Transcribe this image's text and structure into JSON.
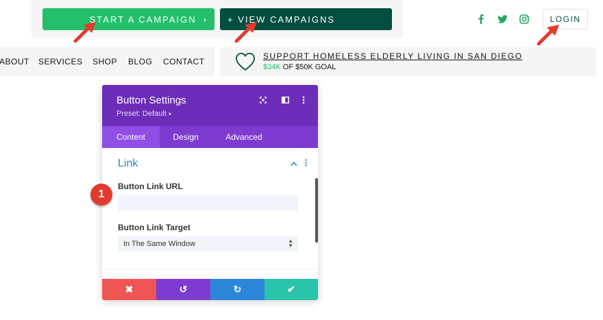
{
  "header": {
    "start_campaign": "START A CAMPAIGN",
    "start_chevron": "›",
    "view_campaigns": "+ VIEW CAMPAIGNS",
    "social_icons": [
      "facebook-icon",
      "twitter-icon",
      "instagram-icon"
    ],
    "login": "LOGIN"
  },
  "nav": {
    "items": [
      "ABOUT",
      "SERVICES",
      "SHOP",
      "BLOG",
      "CONTACT"
    ]
  },
  "support": {
    "title": "SUPPORT HOMELESS ELDERLY LIVING IN SAN DIEGO",
    "amount": "$34K",
    "goal": "OF $50K GOAL",
    "icon": "heart-icon"
  },
  "panel": {
    "title": "Button Settings",
    "preset": "Preset: Default",
    "preset_caret": "▾",
    "tabs": [
      "Content",
      "Design",
      "Advanced"
    ],
    "section": "Link",
    "url_label": "Button Link URL",
    "url_value": "",
    "target_label": "Button Link Target",
    "target_value": "In The Same Window",
    "actions": [
      "✖",
      "↺",
      "↻",
      "✔"
    ]
  },
  "annotation": {
    "badge": "1"
  },
  "colors": {
    "brand_green": "#23bf6a",
    "dark_green": "#034e3f",
    "panel_purple": "#6c2eb9",
    "cancel": "#ef5555",
    "undo": "#7e3bd0",
    "redo": "#2b87da",
    "save": "#29c4a9",
    "annotation_red": "#e23b2e"
  }
}
